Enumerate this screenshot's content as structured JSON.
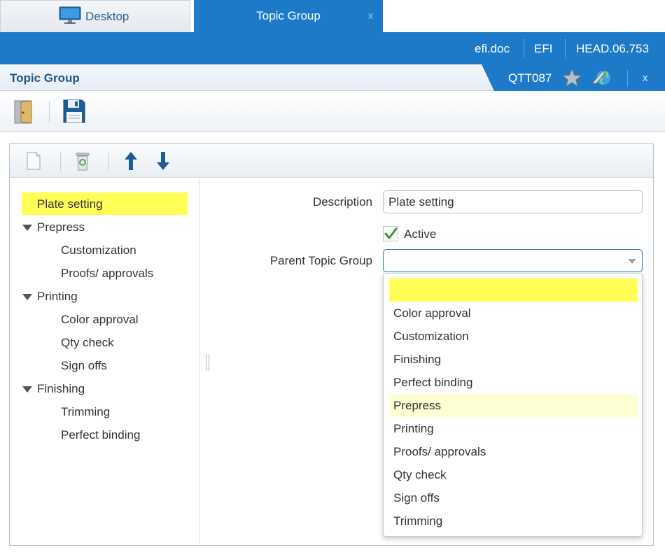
{
  "tabs": {
    "desktop_label": "Desktop",
    "active_label": "Topic Group",
    "active_close": "x"
  },
  "infobar": {
    "db": "efi.doc",
    "company": "EFI",
    "version": "HEAD.06.753"
  },
  "titlebar": {
    "title": "Topic Group",
    "code": "QTT087",
    "close": "x"
  },
  "tree": {
    "items": [
      {
        "label": "Plate setting",
        "selected": true
      },
      {
        "label": "Prepress",
        "expanded": true
      },
      {
        "label": "Customization"
      },
      {
        "label": "Proofs/ approvals"
      },
      {
        "label": "Printing",
        "expanded": true
      },
      {
        "label": "Color approval"
      },
      {
        "label": "Qty check"
      },
      {
        "label": "Sign offs"
      },
      {
        "label": "Finishing",
        "expanded": true
      },
      {
        "label": "Trimming"
      },
      {
        "label": "Perfect binding"
      }
    ]
  },
  "form": {
    "description_label": "Description",
    "description_value": "Plate setting",
    "active_label": "Active",
    "active_checked": true,
    "parent_label": "Parent Topic Group",
    "parent_value": ""
  },
  "dropdown": {
    "options": [
      "",
      "Color approval",
      "Customization",
      "Finishing",
      "Perfect binding",
      "Prepress",
      "Printing",
      "Proofs/ approvals",
      "Qty check",
      "Sign offs",
      "Trimming"
    ],
    "highlighted": "Prepress"
  },
  "colors": {
    "brand_blue": "#1d7ac8",
    "selection_yellow": "#ffff55",
    "hover_yellow": "#ffffd4"
  }
}
